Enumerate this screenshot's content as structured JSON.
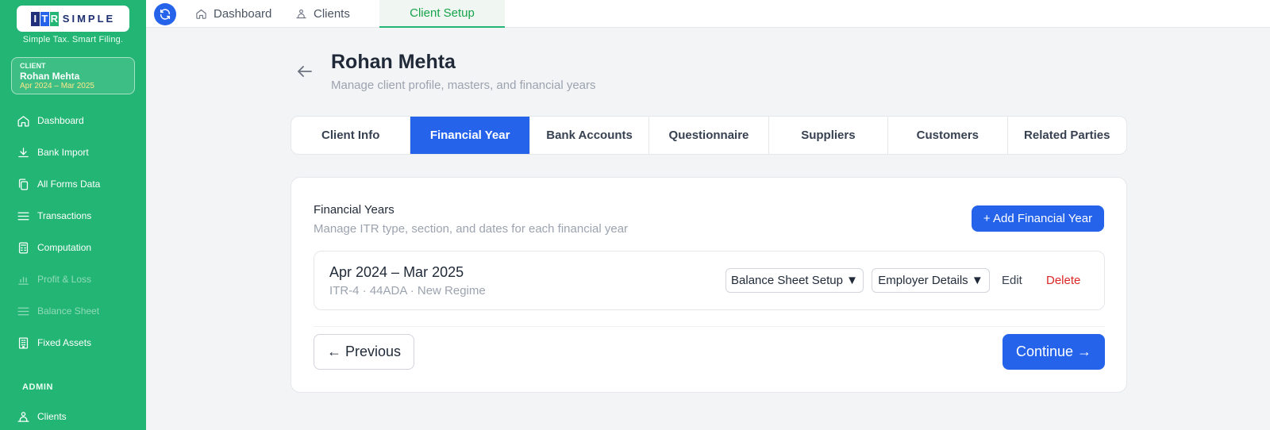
{
  "brand": {
    "logo_letters": [
      "I",
      "T",
      "R"
    ],
    "logo_word": "SIMPLE",
    "tagline": "Simple Tax. Smart Filing."
  },
  "client_card": {
    "label": "CLIENT",
    "name": "Rohan Mehta",
    "period": "Apr 2024 – Mar 2025"
  },
  "sidebar": {
    "items": [
      {
        "label": "Dashboard",
        "icon": "home-icon"
      },
      {
        "label": "Bank Import",
        "icon": "download-icon"
      },
      {
        "label": "All Forms Data",
        "icon": "copy-icon"
      },
      {
        "label": "Transactions",
        "icon": "list-icon"
      },
      {
        "label": "Computation",
        "icon": "calculator-icon"
      },
      {
        "label": "Profit & Loss",
        "icon": "chart-icon",
        "disabled": true
      },
      {
        "label": "Balance Sheet",
        "icon": "list-icon",
        "disabled": true
      },
      {
        "label": "Fixed Assets",
        "icon": "building-icon"
      }
    ],
    "admin_label": "ADMIN",
    "admin_items": [
      {
        "label": "Clients",
        "icon": "users-icon"
      }
    ]
  },
  "topbar": {
    "tabs": [
      {
        "label": "Dashboard",
        "icon": "home-icon"
      },
      {
        "label": "Clients",
        "icon": "users-icon"
      },
      {
        "label": "Client Setup"
      }
    ],
    "active_tab": "Client Setup"
  },
  "header": {
    "title": "Rohan Mehta",
    "subtitle": "Manage client profile, masters, and financial years"
  },
  "tabs": [
    {
      "label": "Client Info"
    },
    {
      "label": "Financial Year"
    },
    {
      "label": "Bank Accounts"
    },
    {
      "label": "Questionnaire"
    },
    {
      "label": "Suppliers"
    },
    {
      "label": "Customers"
    },
    {
      "label": "Related Parties"
    }
  ],
  "active_tab": "Financial Year",
  "financial_years": {
    "title": "Financial Years",
    "subtitle": "Manage ITR type, section, and dates for each financial year",
    "add_button": "+ Add Financial Year",
    "rows": [
      {
        "period": "Apr 2024 – Mar 2025",
        "meta": "ITR-4 · 44ADA · New Regime",
        "balance_sheet_button": "Balance Sheet Setup ▼",
        "employer_button": "Employer Details ▼",
        "edit": "Edit",
        "delete": "Delete"
      }
    ]
  },
  "footer": {
    "previous": "← Previous",
    "continue": "Continue →"
  },
  "colors": {
    "sidebar": "#22b573",
    "primary": "#2563eb",
    "danger": "#dc2626"
  }
}
